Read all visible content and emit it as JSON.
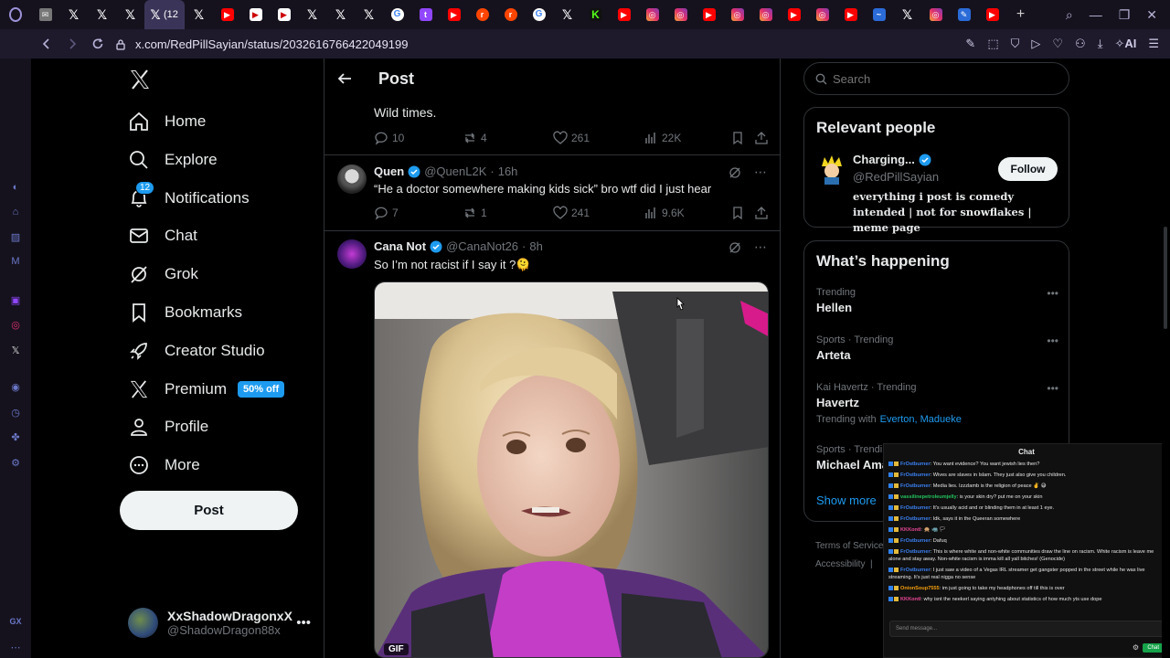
{
  "browser": {
    "tabs": [
      {
        "icon": "mail-icon",
        "glyph": "✉"
      },
      {
        "icon": "x-icon",
        "glyph": "𝕏"
      },
      {
        "icon": "x-icon",
        "glyph": "𝕏"
      },
      {
        "icon": "x-icon",
        "glyph": "𝕏"
      },
      {
        "icon": "x-icon",
        "glyph": "𝕏",
        "label": "(12",
        "active": true
      },
      {
        "icon": "x-icon",
        "glyph": "𝕏"
      },
      {
        "icon": "youtube-icon",
        "glyph": "▶"
      },
      {
        "icon": "player-icon",
        "glyph": "▶"
      },
      {
        "icon": "player-icon",
        "glyph": "▶"
      },
      {
        "icon": "x-icon",
        "glyph": "𝕏"
      },
      {
        "icon": "x-icon",
        "glyph": "𝕏"
      },
      {
        "icon": "x-icon",
        "glyph": "𝕏"
      },
      {
        "icon": "google-icon",
        "glyph": "G"
      },
      {
        "icon": "twitch-icon",
        "glyph": "t"
      },
      {
        "icon": "youtube-icon",
        "glyph": "▶"
      },
      {
        "icon": "reddit-icon",
        "glyph": "r"
      },
      {
        "icon": "reddit-icon",
        "glyph": "r"
      },
      {
        "icon": "google-icon",
        "glyph": "G"
      },
      {
        "icon": "x-icon",
        "glyph": "𝕏"
      },
      {
        "icon": "kick-icon",
        "glyph": "K"
      },
      {
        "icon": "youtube-icon",
        "glyph": "▶"
      },
      {
        "icon": "instagram-icon",
        "glyph": "◎"
      },
      {
        "icon": "instagram-icon",
        "glyph": "◎"
      },
      {
        "icon": "youtube-icon",
        "glyph": "▶"
      },
      {
        "icon": "instagram-icon",
        "glyph": "◎"
      },
      {
        "icon": "instagram-icon",
        "glyph": "◎"
      },
      {
        "icon": "youtube-icon",
        "glyph": "▶"
      },
      {
        "icon": "instagram-icon",
        "glyph": "◎"
      },
      {
        "icon": "youtube-icon",
        "glyph": "▶"
      },
      {
        "icon": "misc-icon",
        "glyph": "~"
      },
      {
        "icon": "x-icon",
        "glyph": "𝕏"
      },
      {
        "icon": "instagram-icon",
        "glyph": "◎"
      },
      {
        "icon": "misc-icon",
        "glyph": "✎"
      },
      {
        "icon": "youtube-icon",
        "glyph": "▶"
      },
      {
        "icon": "new-tab-icon",
        "glyph": "+"
      }
    ],
    "url": "x.com/RedPillSayian/status/2032616766422049199",
    "ai_label": "AI",
    "gx_label": "GX"
  },
  "nav": {
    "items": [
      {
        "label": "Home",
        "icon": "home-icon"
      },
      {
        "label": "Explore",
        "icon": "search-icon"
      },
      {
        "label": "Notifications",
        "icon": "bell-icon",
        "badge": "12"
      },
      {
        "label": "Chat",
        "icon": "mail-icon"
      },
      {
        "label": "Grok",
        "icon": "grok-icon"
      },
      {
        "label": "Bookmarks",
        "icon": "bookmark-icon"
      },
      {
        "label": "Creator Studio",
        "icon": "rocket-icon"
      },
      {
        "label": "Premium",
        "icon": "x-logo-icon",
        "badge": "50% off"
      },
      {
        "label": "Profile",
        "icon": "person-icon"
      },
      {
        "label": "More",
        "icon": "more-circle-icon"
      }
    ],
    "post_label": "Post",
    "account": {
      "name": "XxShadowDragonxX",
      "handle": "@ShadowDragon88x"
    }
  },
  "main": {
    "title": "Post",
    "prev_tweet": {
      "text": "Wild times.",
      "replies": "10",
      "reposts": "4",
      "likes": "261",
      "views": "22K"
    },
    "tweets": [
      {
        "name": "Quen",
        "handle": "@QuenL2K",
        "time": "16h",
        "text": "“He a doctor somewhere making kids sick” bro wtf did I just hear",
        "replies": "7",
        "reposts": "1",
        "likes": "241",
        "views": "9.6K"
      },
      {
        "name": "Cana Not",
        "handle": "@CanaNot26",
        "time": "8h",
        "text": "So I’m not racist if I say it ?🫠",
        "media_badge": "GIF"
      }
    ]
  },
  "right": {
    "search_placeholder": "Search",
    "relevant": {
      "title": "Relevant people",
      "name": "Charging...",
      "handle": "@RedPillSayian",
      "follow_label": "Follow",
      "bio": "everything i post is comedy intended | not for snowflakes | meme page"
    },
    "happening": {
      "title": "What’s happening",
      "trends": [
        {
          "category": "Trending",
          "name": "Hellen"
        },
        {
          "category": "Sports · Trending",
          "name": "Arteta"
        },
        {
          "category": "Kai Havertz · Trending",
          "name": "Havertz",
          "with_label": "Trending with",
          "with": "Everton, Madueke"
        },
        {
          "category": "Sports · Trendi",
          "name": "Michael Ama"
        }
      ],
      "show_more": "Show more"
    },
    "footer": {
      "terms": "Terms of Service",
      "accessibility": "Accessibility",
      "sep": "|"
    }
  },
  "chat": {
    "title": "Chat",
    "messages": [
      {
        "user": "FrOstburner",
        "user_color": "#3b82f6",
        "text": "You want evidence? You want jewish lies then?"
      },
      {
        "user": "FrOstburner",
        "user_color": "#3b82f6",
        "text": "Wives are slaves in Islam. They just also give you children."
      },
      {
        "user": "FrOstburner",
        "user_color": "#3b82f6",
        "text": "Media lies. Izzzlamb is the religion of peace ✌️ 😅"
      },
      {
        "user": "vassilinepetroleumjelly",
        "user_color": "#22c55e",
        "text": "is your skin dry? put me on your skin"
      },
      {
        "user": "FrOstburner",
        "user_color": "#3b82f6",
        "text": "It's usually acid and or blinding them in at least 1 eye."
      },
      {
        "user": "FrOstburner",
        "user_color": "#3b82f6",
        "text": "Idk, says it in the Queeran somewhere"
      },
      {
        "user": "KKKontl",
        "user_color": "#ec4899",
        "text": "🙊 🦏 🏳"
      },
      {
        "user": "FrOstburner",
        "user_color": "#3b82f6",
        "text": "Dafuq"
      },
      {
        "user": "FrOstburner",
        "user_color": "#3b82f6",
        "text": "This is where white and non-white communities draw the line on racism. White racism is leave me alone and stay away. Non-white racism is imma kill all yall bitches! (Genocide)"
      },
      {
        "user": "FrOstburner",
        "user_color": "#3b82f6",
        "text": "I just saw a video of a Vegas IRL streamer get gangster popped in the street while he was live streaming. It's just real nigga no sense"
      },
      {
        "user": "OnionSoup7555",
        "user_color": "#f59e0b",
        "text": "im just going to take my headphones off till this is over"
      },
      {
        "user": "KKKontl",
        "user_color": "#ec4899",
        "text": "why isnt the neekerl saying antyhing about statistics of how much yts use dope"
      }
    ],
    "input_placeholder": "Send message...",
    "send_label": "Chat"
  }
}
